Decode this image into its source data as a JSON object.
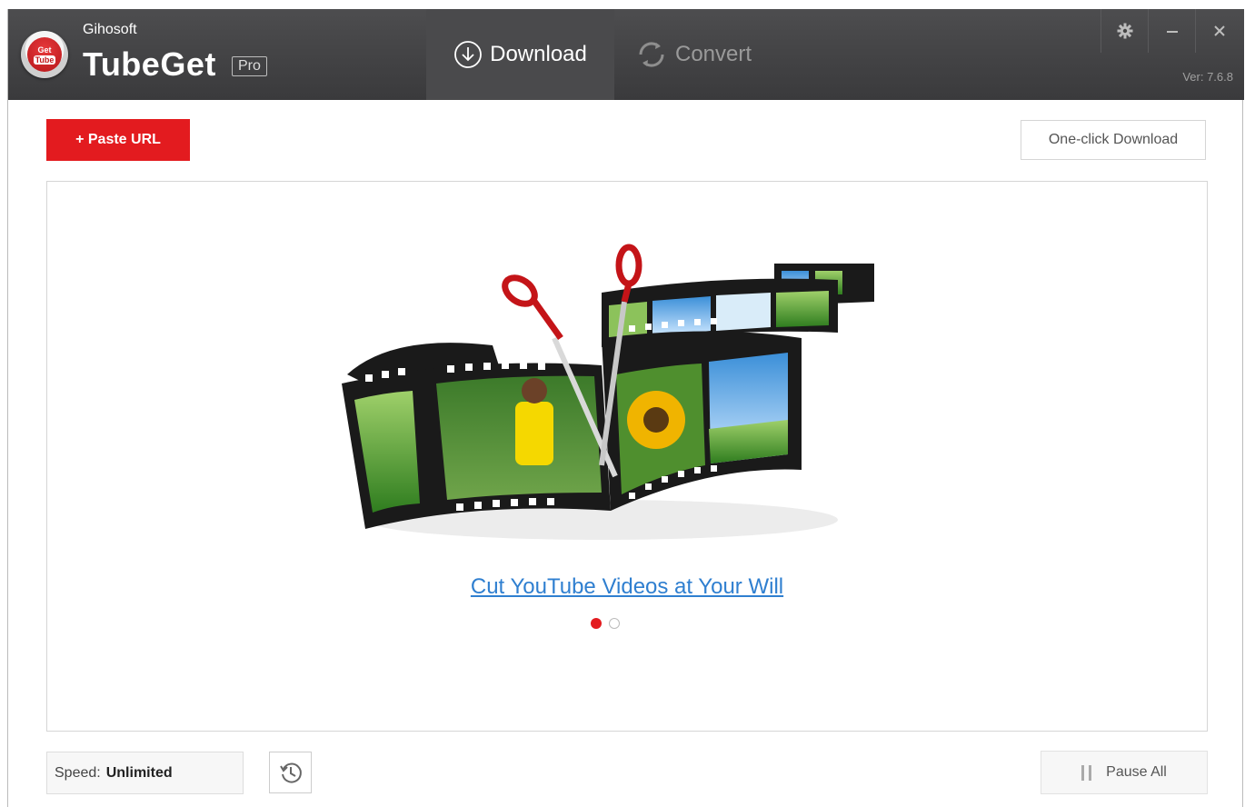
{
  "app": {
    "logo_text_top": "Get",
    "logo_text_bottom": "Tube",
    "vendor": "Gihosoft",
    "name": "TubeGet",
    "edition": "Pro",
    "version": "Ver: 7.6.8"
  },
  "tabs": [
    {
      "label": "Download",
      "icon": "download-circle-icon",
      "active": true
    },
    {
      "label": "Convert",
      "icon": "convert-cycle-icon",
      "active": false
    }
  ],
  "window_controls": {
    "settings_icon": "gear-icon",
    "minimize_icon": "minimize-icon",
    "close_icon": "close-icon"
  },
  "toolbar": {
    "paste_url_label": "+ Paste URL",
    "one_click_label": "One-click Download"
  },
  "banner": {
    "caption": "Cut YouTube Videos at Your Will",
    "slide_count": 2,
    "active_slide": 1
  },
  "footer": {
    "speed_label": "Speed:",
    "speed_value": "Unlimited",
    "history_icon": "history-clock-icon",
    "pause_all_label": "Pause All"
  },
  "colors": {
    "accent_red": "#e31b1f",
    "titlebar": "#3f3f41",
    "link_blue": "#2f7fd0"
  }
}
